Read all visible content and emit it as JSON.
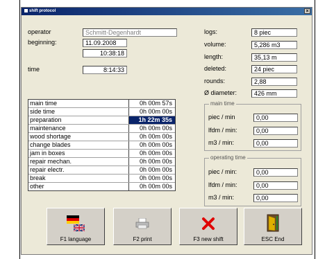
{
  "window": {
    "title": "shift protocol",
    "close": "×"
  },
  "left": {
    "operator_label": "operator",
    "operator_value": "Schmitt-Degenhardt",
    "beginning_label": "beginning:",
    "beginning_date": "11.09.2008",
    "beginning_time": "10:38:18",
    "time_label": "time",
    "time_value": "8:14:33"
  },
  "stats": {
    "logs_label": "logs:",
    "logs_value": "8 piec",
    "volume_label": "volume:",
    "volume_value": "5,286 m3",
    "length_label": "length:",
    "length_value": "35,13 m",
    "deleted_label": "deleted:",
    "deleted_value": "24 piec",
    "rounds_label": "rounds:",
    "rounds_value": "2,88",
    "diameter_label": "Ø diameter:",
    "diameter_value": "426 mm"
  },
  "table": {
    "rows": [
      {
        "name": "main time",
        "value": "0h 00m 57s"
      },
      {
        "name": "side time",
        "value": "0h 00m 00s"
      },
      {
        "name": "preparation",
        "value": "1h 22m 35s"
      },
      {
        "name": "maintenance",
        "value": "0h 00m 00s"
      },
      {
        "name": "wood shortage",
        "value": "0h 00m 00s"
      },
      {
        "name": "change blades",
        "value": "0h 00m 00s"
      },
      {
        "name": "jam in boxes",
        "value": "0h 00m 00s"
      },
      {
        "name": "repair mechan.",
        "value": "0h 00m 00s"
      },
      {
        "name": "repair electr.",
        "value": "0h 00m 00s"
      },
      {
        "name": "break",
        "value": "0h 00m 00s"
      },
      {
        "name": "other",
        "value": "0h 00m 00s"
      }
    ],
    "selected_index": 2
  },
  "main_time": {
    "title": "main time",
    "piec_label": "piec / min",
    "piec_value": "0,00",
    "lfdm_label": "lfdm / min:",
    "lfdm_value": "0,00",
    "m3_label": "m3 / min:",
    "m3_value": "0,00"
  },
  "operating_time": {
    "title": "operating time",
    "piec_label": "piec / min:",
    "piec_value": "0,00",
    "lfdm_label": "lfdm / min:",
    "lfdm_value": "0,00",
    "m3_label": "m3 / min:",
    "m3_value": "0,00"
  },
  "buttons": {
    "language": "F1 language",
    "print": "F2 print",
    "new_shift": "F3 new shift",
    "end": "ESC End"
  },
  "colors": {
    "selection": "#0a246a",
    "window_bg": "#ece9d8"
  }
}
